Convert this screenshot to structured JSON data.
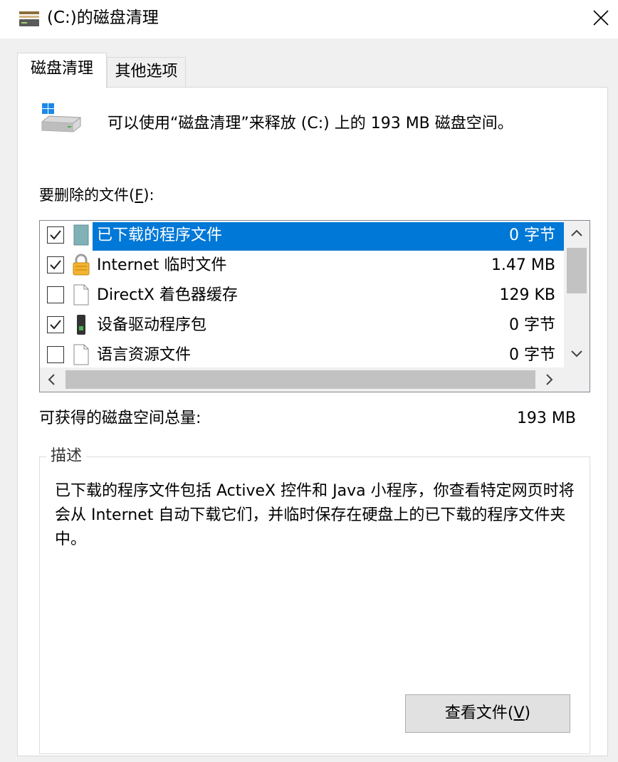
{
  "window": {
    "title": "(C:)的磁盘清理",
    "icon": "disk-cleanup-icon"
  },
  "tabs": [
    {
      "label": "磁盘清理",
      "active": true
    },
    {
      "label": "其他选项",
      "active": false
    }
  ],
  "header": {
    "text": "可以使用“磁盘清理”来释放 (C:) 上的 193 MB 磁盘空间。",
    "icon": "drive-icon"
  },
  "files_label": {
    "prefix": "要删除的文件(",
    "accel": "F",
    "suffix": "):"
  },
  "file_list": [
    {
      "name": "已下载的程序文件",
      "size": "0 字节",
      "checked": true,
      "selected": true,
      "icon": "folder-icon"
    },
    {
      "name": "Internet 临时文件",
      "size": "1.47 MB",
      "checked": true,
      "selected": false,
      "icon": "lock-icon"
    },
    {
      "name": "DirectX 着色器缓存",
      "size": "129 KB",
      "checked": false,
      "selected": false,
      "icon": "file-icon"
    },
    {
      "name": "设备驱动程序包",
      "size": "0 字节",
      "checked": true,
      "selected": false,
      "icon": "device-icon"
    },
    {
      "name": "语言资源文件",
      "size": "0 字节",
      "checked": false,
      "selected": false,
      "icon": "file-icon"
    }
  ],
  "total": {
    "label": "可获得的磁盘空间总量:",
    "value": "193 MB"
  },
  "description": {
    "title": "描述",
    "text": "已下载的程序文件包括 ActiveX 控件和 Java 小程序，你查看特定网页时将会从 Internet 自动下载它们，并临时保存在硬盘上的已下载的程序文件夹中。"
  },
  "view_button": {
    "prefix": "查看文件(",
    "accel": "V",
    "suffix": ")"
  },
  "colors": {
    "selection": "#0078d7",
    "dialog_bg": "#f0f0f0"
  }
}
